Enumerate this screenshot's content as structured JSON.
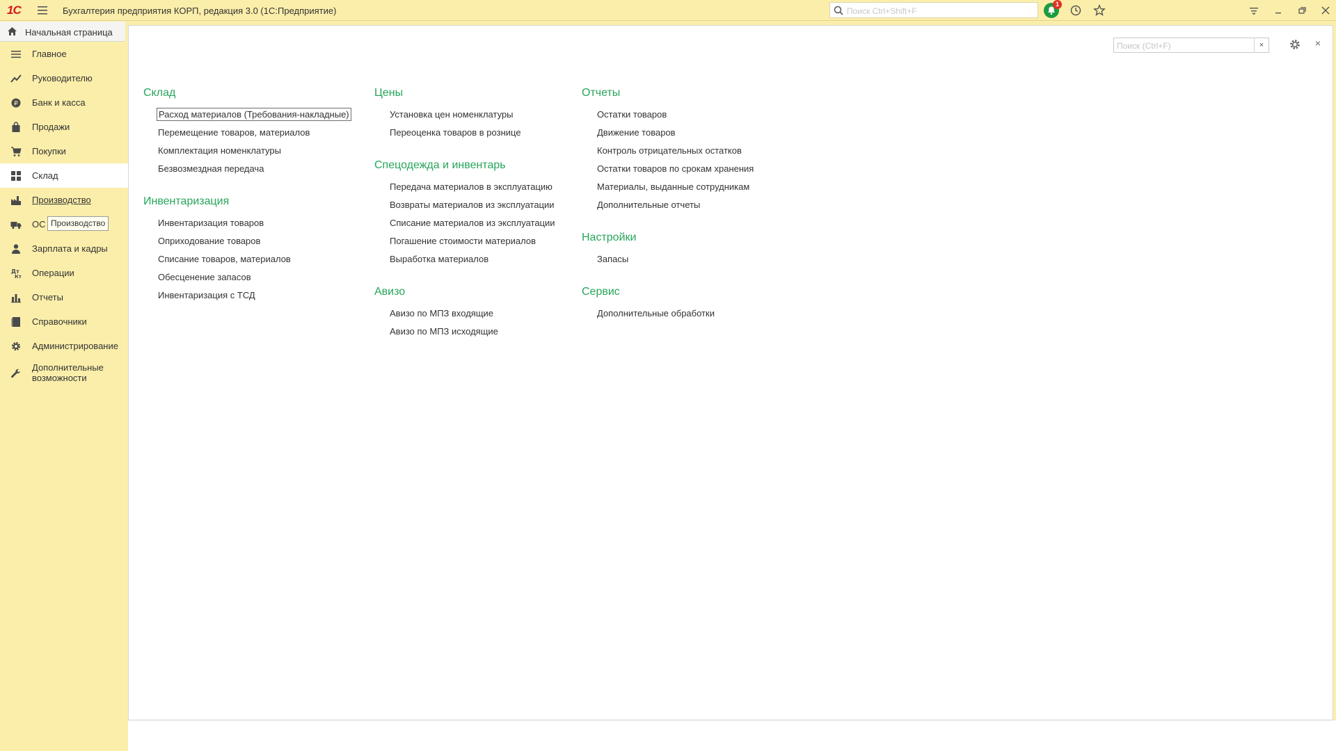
{
  "window": {
    "title": "Бухгалтерия предприятия КОРП, редакция 3.0  (1С:Предприятие)",
    "logo_text": "1С",
    "search_placeholder": "Поиск Ctrl+Shift+F",
    "notification_count": "1",
    "colors": {
      "accent_green": "#27a55a",
      "panel_yellow": "#fbeeaa",
      "notify_green": "#1e9b3f",
      "badge_red": "#e33124"
    }
  },
  "home_tab": {
    "label": "Начальная страница",
    "icon": "home-icon"
  },
  "sidebar": {
    "items": [
      {
        "label": "Главное",
        "icon": "menu-lines-icon"
      },
      {
        "label": "Руководителю",
        "icon": "trend-chart-icon"
      },
      {
        "label": "Банк и касса",
        "icon": "coin-icon"
      },
      {
        "label": "Продажи",
        "icon": "shopping-bag-icon"
      },
      {
        "label": "Покупки",
        "icon": "shopping-cart-icon"
      },
      {
        "label": "Склад",
        "icon": "warehouse-grid-icon"
      },
      {
        "label": "Производство",
        "icon": "factory-icon"
      },
      {
        "label": "ОС",
        "icon": "truck-icon"
      },
      {
        "label": "Зарплата и кадры",
        "icon": "person-icon"
      },
      {
        "label": "Операции",
        "icon": "operations-icon"
      },
      {
        "label": "Отчеты",
        "icon": "bar-chart-icon"
      },
      {
        "label": "Справочники",
        "icon": "book-icon"
      },
      {
        "label": "Администрирование",
        "icon": "gear-icon"
      },
      {
        "label": "Дополнительные возможности",
        "icon": "wrench-icon"
      }
    ],
    "tooltip": "Производство"
  },
  "main": {
    "search_placeholder": "Поиск (Ctrl+F)",
    "clear_label": "×",
    "close_label": "×",
    "columns": [
      {
        "sections": [
          {
            "title": "Склад",
            "links": [
              "Расход материалов (Требования-накладные)",
              "Перемещение товаров, материалов",
              "Комплектация номенклатуры",
              "Безвозмездная передача"
            ]
          },
          {
            "title": "Инвентаризация",
            "links": [
              "Инвентаризация товаров",
              "Оприходование товаров",
              "Списание товаров, материалов",
              "Обесценение запасов",
              "Инвентаризация с ТСД"
            ]
          }
        ]
      },
      {
        "sections": [
          {
            "title": "Цены",
            "links": [
              "Установка цен номенклатуры",
              "Переоценка товаров в рознице"
            ]
          },
          {
            "title": "Спецодежда и инвентарь",
            "links": [
              "Передача материалов в эксплуатацию",
              "Возвраты материалов из эксплуатации",
              "Списание материалов из эксплуатации",
              "Погашение стоимости материалов",
              "Выработка материалов"
            ]
          },
          {
            "title": "Авизо",
            "links": [
              "Авизо по МПЗ входящие",
              "Авизо по МПЗ исходящие"
            ]
          }
        ]
      },
      {
        "sections": [
          {
            "title": "Отчеты",
            "links": [
              "Остатки товаров",
              "Движение товаров",
              "Контроль отрицательных остатков",
              "Остатки товаров по срокам хранения",
              "Материалы, выданные сотрудникам",
              "Дополнительные отчеты"
            ]
          },
          {
            "title": "Настройки",
            "links": [
              "Запасы"
            ]
          },
          {
            "title": "Сервис",
            "links": [
              "Дополнительные обработки"
            ]
          }
        ]
      }
    ]
  }
}
